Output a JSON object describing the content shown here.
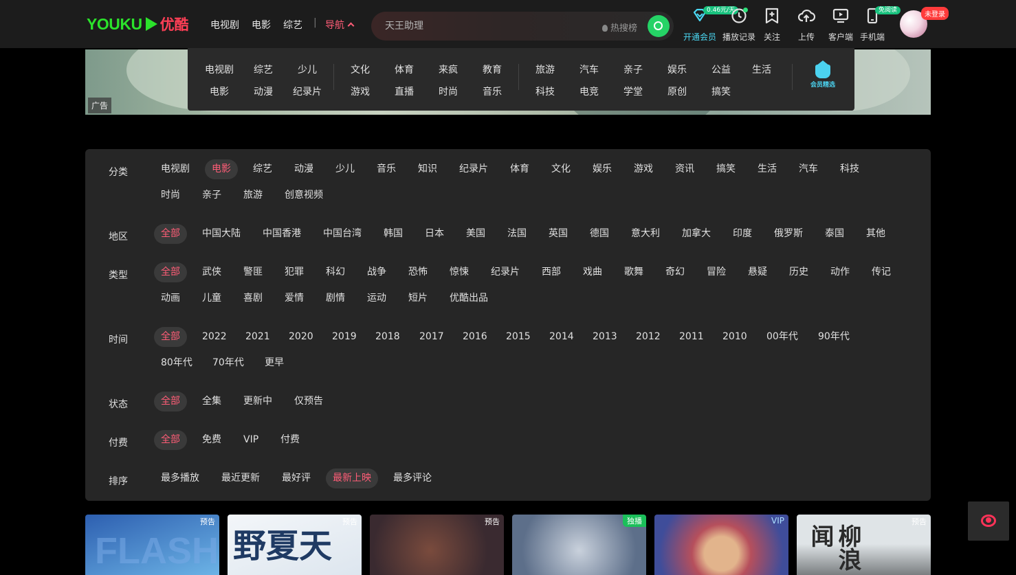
{
  "header": {
    "logo_text": "YOUKU",
    "logo_cn": "优酷",
    "nav": [
      "电视剧",
      "电影",
      "综艺"
    ],
    "nav_sep": "|",
    "nav_menu": "导航",
    "search": {
      "placeholder": "天王助理",
      "hot_label": "热搜榜"
    },
    "tools": [
      {
        "label": "开通会员",
        "icon": "diamond-icon",
        "tag": "0.46元/天"
      },
      {
        "label": "播放记录",
        "icon": "clock-icon"
      },
      {
        "label": "关注",
        "icon": "bookmark-plus-icon"
      },
      {
        "label": "上传",
        "icon": "cloud-upload-icon"
      },
      {
        "label": "客户端",
        "icon": "monitor-play-icon"
      },
      {
        "label": "手机端",
        "icon": "phone-icon",
        "tag": "免阅读"
      }
    ],
    "login_badge": "未登录"
  },
  "ad": {
    "tag": "广告"
  },
  "dropdown": {
    "groups": [
      [
        "电视剧",
        "综艺",
        "少儿",
        "电影",
        "动漫",
        "纪录片"
      ],
      [
        "文化",
        "体育",
        "来疯",
        "教育",
        "游戏",
        "直播",
        "时尚",
        "音乐"
      ],
      [
        "旅游",
        "汽车",
        "亲子",
        "娱乐",
        "公益",
        "生活",
        "科技",
        "电竞",
        "学堂",
        "原创",
        "搞笑"
      ]
    ],
    "vip_pick": "会员精选"
  },
  "filters": {
    "category": {
      "label": "分类",
      "options": [
        "电视剧",
        "电影",
        "综艺",
        "动漫",
        "少儿",
        "音乐",
        "知识",
        "纪录片",
        "体育",
        "文化",
        "娱乐",
        "游戏",
        "资讯",
        "搞笑",
        "生活",
        "汽车",
        "科技",
        "时尚",
        "亲子",
        "旅游",
        "创意视频"
      ],
      "selected": "电影"
    },
    "region": {
      "label": "地区",
      "options": [
        "全部",
        "中国大陆",
        "中国香港",
        "中国台湾",
        "韩国",
        "日本",
        "美国",
        "法国",
        "英国",
        "德国",
        "意大利",
        "加拿大",
        "印度",
        "俄罗斯",
        "泰国",
        "其他"
      ],
      "selected": "全部"
    },
    "genre": {
      "label": "类型",
      "options": [
        "全部",
        "武侠",
        "警匪",
        "犯罪",
        "科幻",
        "战争",
        "恐怖",
        "惊悚",
        "纪录片",
        "西部",
        "戏曲",
        "歌舞",
        "奇幻",
        "冒险",
        "悬疑",
        "历史",
        "动作",
        "传记",
        "动画",
        "儿童",
        "喜剧",
        "爱情",
        "剧情",
        "运动",
        "短片",
        "优酷出品"
      ],
      "selected": "全部"
    },
    "time": {
      "label": "时间",
      "options": [
        "全部",
        "2022",
        "2021",
        "2020",
        "2019",
        "2018",
        "2017",
        "2016",
        "2015",
        "2014",
        "2013",
        "2012",
        "2011",
        "2010",
        "00年代",
        "90年代",
        "80年代",
        "70年代",
        "更早"
      ],
      "selected": "全部"
    },
    "status": {
      "label": "状态",
      "options": [
        "全部",
        "全集",
        "更新中",
        "仅预告"
      ],
      "selected": "全部"
    },
    "pay": {
      "label": "付费",
      "options": [
        "全部",
        "免费",
        "VIP",
        "付费"
      ],
      "selected": "全部"
    },
    "sort": {
      "label": "排序",
      "options": [
        "最多播放",
        "最近更新",
        "最好评",
        "最新上映",
        "最多评论"
      ],
      "selected": "最新上映"
    }
  },
  "posters": [
    {
      "badge": "预告",
      "art": "FLASH",
      "colors": [
        "#2d5fb0",
        "#6fb7e8"
      ]
    },
    {
      "badge": "预告",
      "art": "野夏天",
      "colors": [
        "#f3f6f9",
        "#dce5ee"
      ]
    },
    {
      "badge": "预告",
      "art": "",
      "colors": [
        "#3a2a30",
        "#7a4b3d"
      ]
    },
    {
      "badge": "独播",
      "art": "",
      "colors": [
        "#5d6f8a",
        "#c9d1dc"
      ]
    },
    {
      "badge": "VIP",
      "art": "",
      "colors": [
        "#3f4d9a",
        "#b64f5c"
      ]
    },
    {
      "badge": "预告",
      "art": "柳浪闻",
      "colors": [
        "#dfe4e7",
        "#6a6e70"
      ]
    }
  ]
}
